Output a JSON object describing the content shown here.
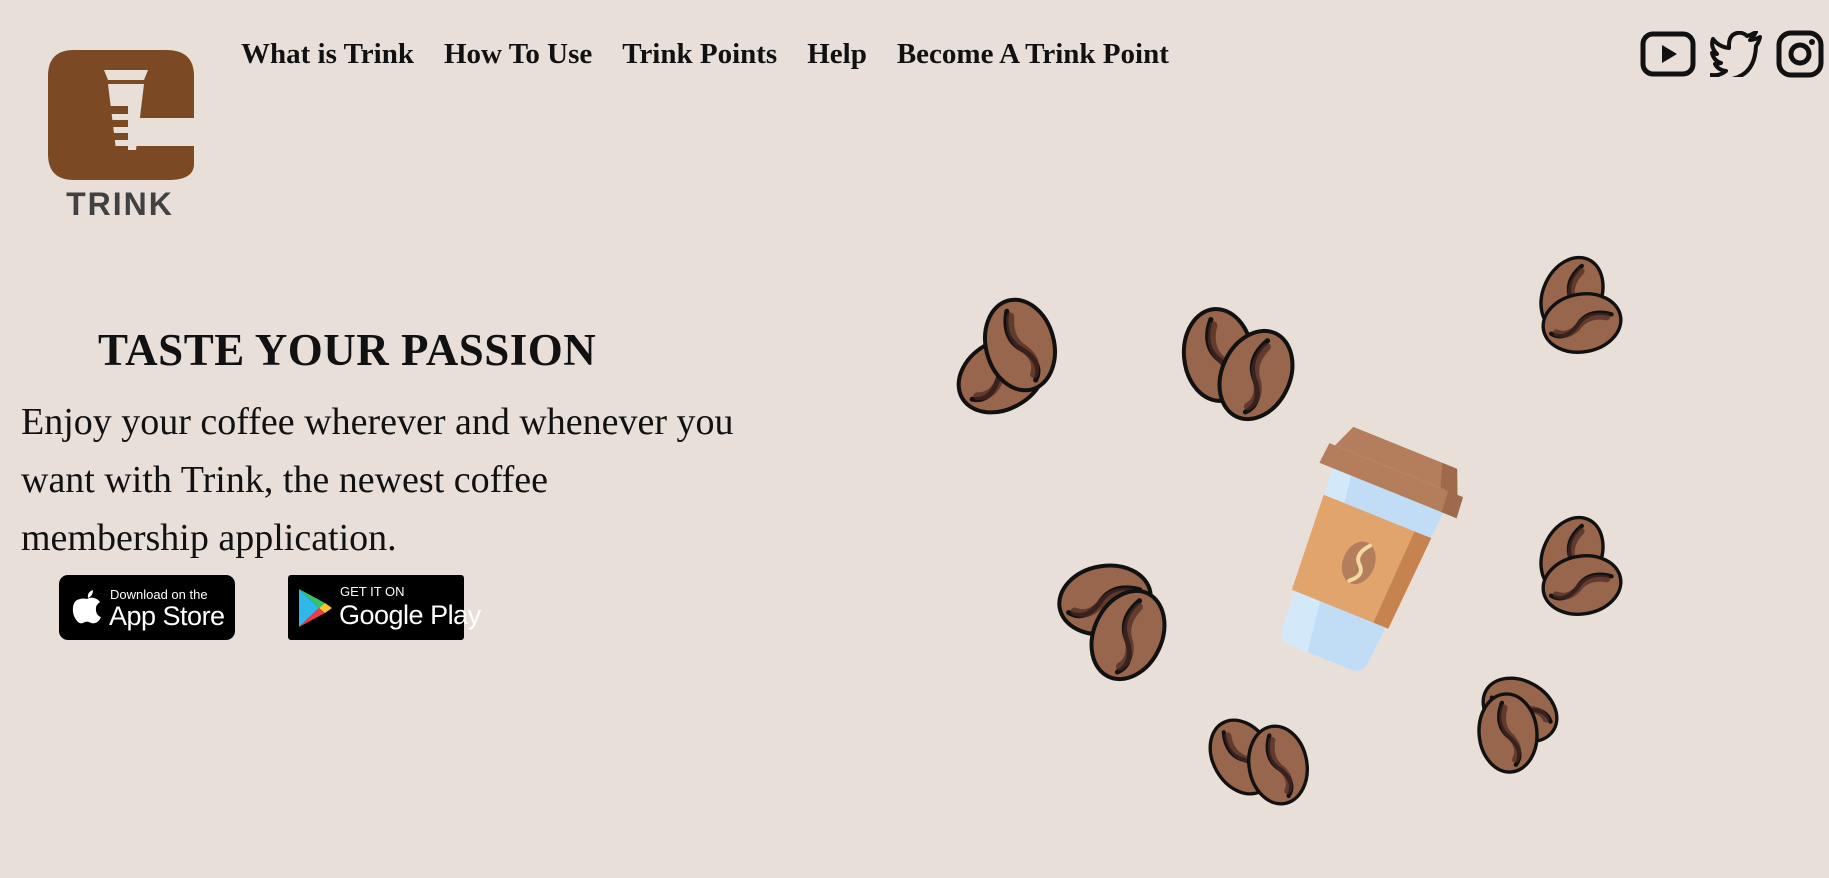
{
  "brand": {
    "name": "TRINK",
    "color": "#7b4a24"
  },
  "nav": {
    "items": [
      "What is Trink",
      "How To Use",
      "Trink Points",
      "Help",
      "Become A Trink Point"
    ]
  },
  "social": {
    "icons": [
      "youtube-icon",
      "twitter-icon",
      "instagram-icon"
    ]
  },
  "hero": {
    "title": "TASTE YOUR PASSION",
    "text": "Enjoy your coffee wherever and whenever you want with Trink, the newest coffee membership application."
  },
  "stores": {
    "apple": {
      "small": "Download on the",
      "big": "App Store"
    },
    "google": {
      "small": "GET IT ON",
      "big": "Google Play"
    }
  },
  "colors": {
    "background": "#e8e0d8",
    "bean": "#98664c",
    "cup_lid": "#b47d5b",
    "cup_sleeve": "#e0a46c",
    "cup_body": "#d3e8f9"
  }
}
